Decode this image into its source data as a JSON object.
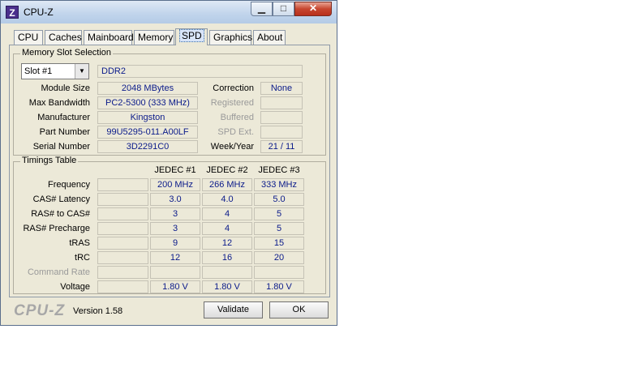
{
  "window": {
    "title": "CPU-Z",
    "icon_letter": "Z"
  },
  "tabs": [
    "CPU",
    "Caches",
    "Mainboard",
    "Memory",
    "SPD",
    "Graphics",
    "About"
  ],
  "active_tab": "SPD",
  "slot": {
    "group_title": "Memory Slot Selection",
    "selected": "Slot #1",
    "type": "DDR2",
    "rows": [
      {
        "label": "Module Size",
        "value": "2048 MBytes"
      },
      {
        "label": "Max Bandwidth",
        "value": "PC2-5300 (333 MHz)"
      },
      {
        "label": "Manufacturer",
        "value": "Kingston"
      },
      {
        "label": "Part Number",
        "value": "99U5295-011.A00LF"
      },
      {
        "label": "Serial Number",
        "value": "3D2291C0"
      }
    ],
    "right_rows": [
      {
        "label": "Correction",
        "value": "None",
        "enabled": true
      },
      {
        "label": "Registered",
        "value": "",
        "enabled": false
      },
      {
        "label": "Buffered",
        "value": "",
        "enabled": false
      },
      {
        "label": "SPD Ext.",
        "value": "",
        "enabled": false
      },
      {
        "label": "Week/Year",
        "value": "21 / 11",
        "enabled": true
      }
    ]
  },
  "timings": {
    "group_title": "Timings Table",
    "columns": [
      "JEDEC #1",
      "JEDEC #2",
      "JEDEC #3"
    ],
    "rows": [
      {
        "label": "Frequency",
        "values": [
          "200 MHz",
          "266 MHz",
          "333 MHz"
        ],
        "enabled": true
      },
      {
        "label": "CAS# Latency",
        "values": [
          "3.0",
          "4.0",
          "5.0"
        ],
        "enabled": true
      },
      {
        "label": "RAS# to CAS#",
        "values": [
          "3",
          "4",
          "5"
        ],
        "enabled": true
      },
      {
        "label": "RAS# Precharge",
        "values": [
          "3",
          "4",
          "5"
        ],
        "enabled": true
      },
      {
        "label": "tRAS",
        "values": [
          "9",
          "12",
          "15"
        ],
        "enabled": true
      },
      {
        "label": "tRC",
        "values": [
          "12",
          "16",
          "20"
        ],
        "enabled": true
      },
      {
        "label": "Command Rate",
        "values": [
          "",
          "",
          ""
        ],
        "enabled": false
      },
      {
        "label": "Voltage",
        "values": [
          "1.80 V",
          "1.80 V",
          "1.80 V"
        ],
        "enabled": true
      }
    ]
  },
  "footer": {
    "logo": "CPU-Z",
    "version": "Version 1.58",
    "validate": "Validate",
    "ok": "OK"
  }
}
